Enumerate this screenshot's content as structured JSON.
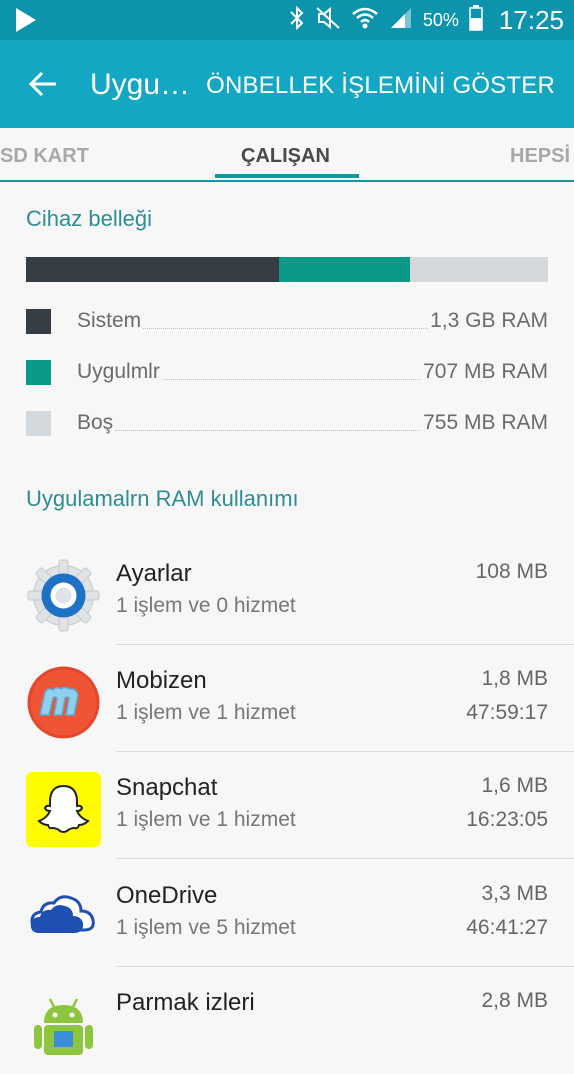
{
  "status_bar": {
    "battery_percent": "50%",
    "time": "17:25"
  },
  "app_bar": {
    "title": "Uygu…",
    "action": "ÖNBELLEK İŞLEMİNİ GÖSTER"
  },
  "tabs": [
    {
      "label": "SD KART",
      "active": false
    },
    {
      "label": "ÇALIŞAN",
      "active": true
    },
    {
      "label": "HEPSİ",
      "active": false
    }
  ],
  "memory": {
    "title": "Cihaz belleği",
    "items": [
      {
        "label": "Sistem",
        "value": "1,3 GB RAM",
        "color": "#373d45",
        "fraction": 0.485
      },
      {
        "label": "Uygulmlr",
        "value": "707 MB RAM",
        "color": "#0b9988",
        "fraction": 0.25
      },
      {
        "label": "Boş",
        "value": "755 MB RAM",
        "color": "#d3d8dc",
        "fraction": 0.265
      }
    ]
  },
  "apps_section": {
    "title": "Uygulamalrn RAM kullanımı",
    "apps": [
      {
        "name": "Ayarlar",
        "detail": "1 işlem ve 0 hizmet",
        "size": "108 MB",
        "time": "",
        "icon": "settings-gear-icon"
      },
      {
        "name": "Mobizen",
        "detail": "1 işlem ve 1 hizmet",
        "size": "1,8 MB",
        "time": "47:59:17",
        "icon": "mobizen-icon"
      },
      {
        "name": "Snapchat",
        "detail": "1 işlem ve 1 hizmet",
        "size": "1,6 MB",
        "time": "16:23:05",
        "icon": "snapchat-ghost-icon"
      },
      {
        "name": "OneDrive",
        "detail": "1 işlem ve 5 hizmet",
        "size": "3,3 MB",
        "time": "46:41:27",
        "icon": "onedrive-cloud-icon"
      },
      {
        "name": "Parmak izleri",
        "detail": "",
        "size": "2,8 MB",
        "time": "",
        "icon": "android-robot-icon"
      }
    ]
  }
}
